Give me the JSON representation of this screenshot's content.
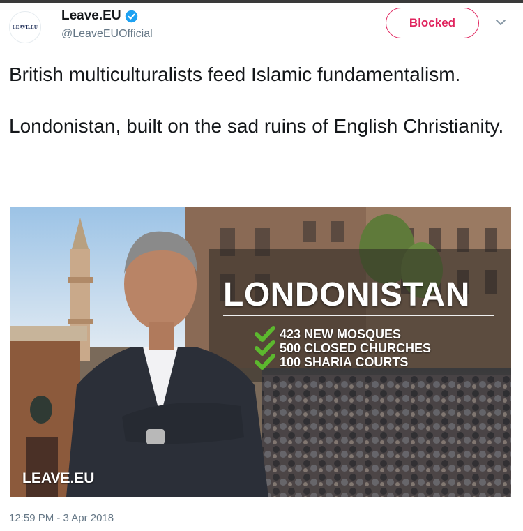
{
  "account": {
    "avatar_text": "LEAVE.EU",
    "display_name": "Leave.EU",
    "handle": "@LeaveEUOfficial",
    "verified": true
  },
  "actions": {
    "blocked_label": "Blocked",
    "menu_icon": "chevron-down-icon"
  },
  "tweet": {
    "paragraph_1": "British multiculturalists feed Islamic fundamentalism.",
    "paragraph_2": "Londonistan, built on the sad ruins of English Christianity.",
    "timestamp": "12:59 PM - 3 Apr 2018"
  },
  "media": {
    "headline": "LONDONISTAN",
    "stats": [
      "423 NEW MOSQUES",
      "500 CLOSED CHURCHES",
      "100 SHARIA COURTS"
    ],
    "watermark": "LEAVE.EU"
  },
  "colors": {
    "blocked_accent": "#e0245e",
    "verified_blue": "#1da1f2",
    "check_green": "#5cb82e",
    "secondary_text": "#657786"
  }
}
